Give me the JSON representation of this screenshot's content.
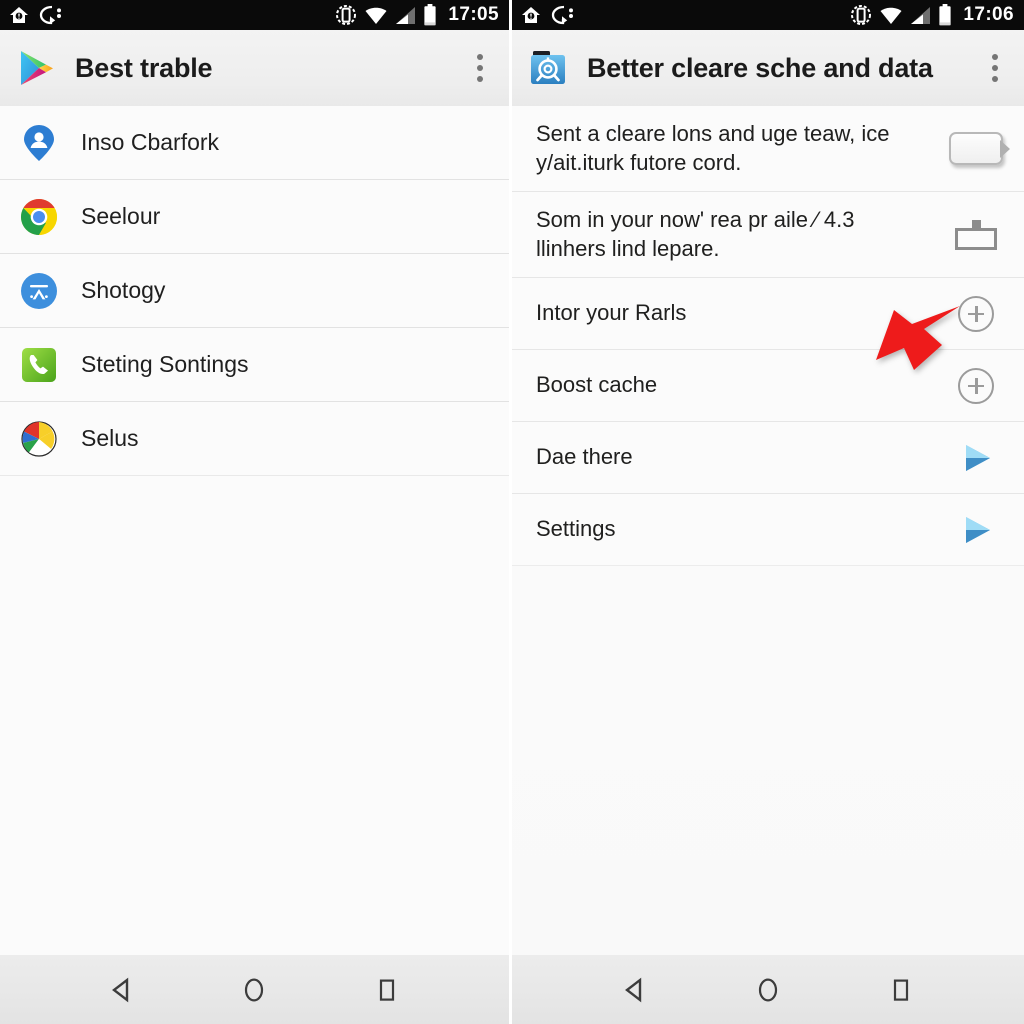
{
  "theme": {
    "statusbar_bg": "#0a0a0a",
    "actionbar_bg": "#eeeeee",
    "content_bg": "#fbfbfb",
    "navbar_bg": "#e8e8e8",
    "divider": "#e2e2e2",
    "text_primary": "#1f1f1f",
    "accent_blue": "#4a90d9",
    "annotation_red": "#ee1b1b",
    "icon_grey": "#9b9b9b"
  },
  "left_panel": {
    "statusbar": {
      "clock": "17:05",
      "notification_icons": [
        "home-alert-icon",
        "sync-off-icon"
      ],
      "system_icons": [
        "screen-rotate-icon",
        "wifi-icon",
        "cellular-signal-icon",
        "battery-icon"
      ]
    },
    "actionbar": {
      "app_icon": "google-play-icon",
      "title": "Best trable",
      "overflow_label": "overflow-menu"
    },
    "list": [
      {
        "icon": "account-pin-icon",
        "label": "Inso Cbarfork"
      },
      {
        "icon": "chrome-icon",
        "label": "Seelour"
      },
      {
        "icon": "appstore-a-icon",
        "label": "Shotogy"
      },
      {
        "icon": "green-phone-icon",
        "label": "Steting Sontings"
      },
      {
        "icon": "color-wheel-icon",
        "label": "Selus"
      }
    ],
    "navbar": {
      "back": "back-button",
      "home": "home-button",
      "recents": "recents-button"
    }
  },
  "right_panel": {
    "statusbar": {
      "clock": "17:06",
      "notification_icons": [
        "home-alert-icon",
        "sync-off-icon"
      ],
      "system_icons": [
        "screen-rotate-icon",
        "wifi-icon",
        "cellular-signal-icon",
        "battery-icon"
      ]
    },
    "actionbar": {
      "app_icon": "blue-folder-gear-icon",
      "title": "Better cleare sche and data",
      "overflow_label": "overflow-menu"
    },
    "rows": [
      {
        "line1": "Sent a cleare lons and uge teaw, ice",
        "line2": "y/ait.iturk futore cord.",
        "widget": "toggle-switch-off",
        "widget_state": "off"
      },
      {
        "line1": "Som in your now' rea pr aile ⁄ 4.3",
        "line2": "llinhers lind lepare.",
        "widget": "outlined-rect-icon",
        "widget_state": "off"
      },
      {
        "line1": "Intor your Rarls",
        "line2": "",
        "widget": "plus-circle-icon"
      },
      {
        "line1": "Boost cache",
        "line2": "",
        "widget": "plus-circle-icon"
      },
      {
        "line1": "Dae there",
        "line2": "",
        "widget": "blue-play-icon"
      },
      {
        "line1": "Settings",
        "line2": "",
        "widget": "blue-play-icon"
      }
    ],
    "annotation": {
      "type": "red-arrow-pointer",
      "color": "#ee1b1b",
      "points_to": "outlined-rect-icon"
    },
    "navbar": {
      "back": "back-button",
      "home": "home-button",
      "recents": "recents-button"
    }
  }
}
